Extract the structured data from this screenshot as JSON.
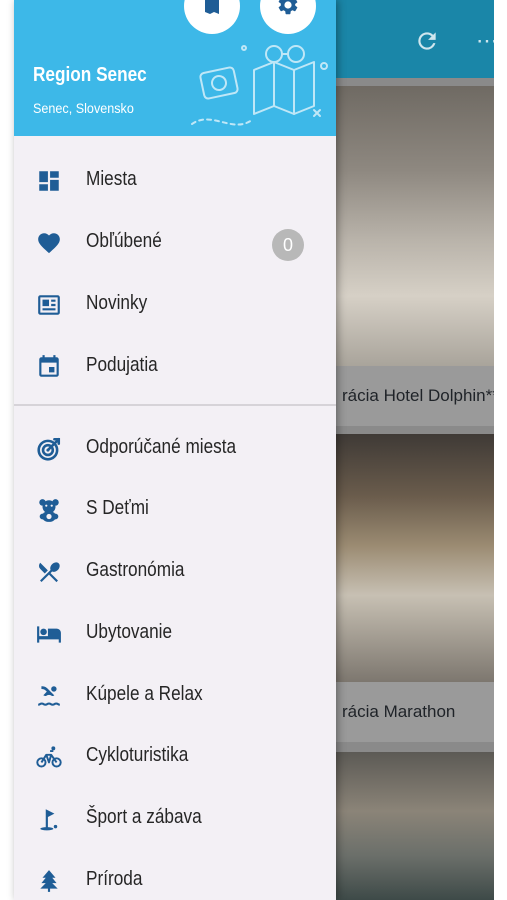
{
  "drawer": {
    "header": {
      "title": "Region Senec",
      "subtitle": "Senec, Slovensko",
      "buttons": [
        {
          "icon": "map-icon"
        },
        {
          "icon": "gear-icon"
        }
      ],
      "color": "#3db8e8"
    },
    "primary_items": [
      {
        "label": "Miesta",
        "icon": "dashboard-icon"
      },
      {
        "label": "Obľúbené",
        "icon": "heart-icon",
        "badge": "0"
      },
      {
        "label": "Novinky",
        "icon": "newspaper-icon"
      },
      {
        "label": "Podujatia",
        "icon": "calendar-icon"
      }
    ],
    "category_items": [
      {
        "label": "Odporúčané miesta",
        "icon": "target-icon"
      },
      {
        "label": "S Deťmi",
        "icon": "teddy-bear-icon"
      },
      {
        "label": "Gastronómia",
        "icon": "fork-knife-icon"
      },
      {
        "label": "Ubytovanie",
        "icon": "bed-icon"
      },
      {
        "label": "Kúpele a Relax",
        "icon": "swimmer-icon"
      },
      {
        "label": "Cykloturistika",
        "icon": "bicycle-icon"
      },
      {
        "label": "Šport a zábava",
        "icon": "golf-flag-icon"
      },
      {
        "label": "Príroda",
        "icon": "tree-icon"
      }
    ],
    "icon_color": "#1f5d96"
  },
  "background": {
    "toolbar_color": "#1a86a8",
    "toolbar_icons": [
      "refresh-icon",
      "more-icon"
    ],
    "cards": [
      {
        "caption": "rácia Hotel Dolphin****"
      },
      {
        "caption": "rácia Marathon"
      }
    ]
  }
}
